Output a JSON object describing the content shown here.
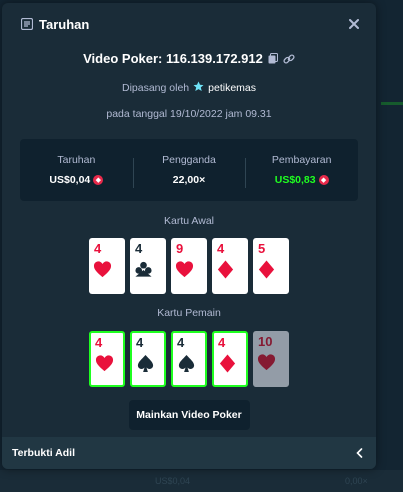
{
  "modal": {
    "title": "Taruhan",
    "game_label": "Video Poker: 116.139.172.912",
    "placed_by_prefix": "Dipasang oleh",
    "username": "petikemas",
    "date_text": "pada tanggal 19/10/2022 jam 09.31"
  },
  "stats": {
    "bet_label": "Taruhan",
    "bet_value": "US$0,04",
    "multiplier_label": "Pengganda",
    "multiplier_value": "22,00×",
    "payout_label": "Pembayaran",
    "payout_value": "US$0,83"
  },
  "initial_hand": {
    "label": "Kartu Awal",
    "cards": [
      {
        "rank": "4",
        "suit": "heart"
      },
      {
        "rank": "4",
        "suit": "club"
      },
      {
        "rank": "9",
        "suit": "heart"
      },
      {
        "rank": "4",
        "suit": "diamond"
      },
      {
        "rank": "5",
        "suit": "diamond"
      }
    ]
  },
  "player_hand": {
    "label": "Kartu Pemain",
    "cards": [
      {
        "rank": "4",
        "suit": "heart",
        "held": true
      },
      {
        "rank": "4",
        "suit": "spade",
        "held": true
      },
      {
        "rank": "4",
        "suit": "spade",
        "held": true
      },
      {
        "rank": "4",
        "suit": "diamond",
        "held": true
      },
      {
        "rank": "10",
        "suit": "heart",
        "held": false
      }
    ]
  },
  "play_button": "Mainkan Video Poker",
  "fair_label": "Terbukti Adil",
  "background": {
    "amount": "US$0,04",
    "multiplier": "0,00×"
  },
  "colors": {
    "modal_bg": "#1a2c38",
    "panel_bg": "#0f212e",
    "accent_green": "#1fff20",
    "red_suit": "#e9113c",
    "coin_red": "#e8294a",
    "muted_text": "#b1bad3"
  },
  "icons": {
    "title": "bets-icon",
    "copy": "copy-icon",
    "link": "link-icon",
    "user": "star-badge-icon",
    "currency": "coin-icon",
    "close": "close-icon",
    "fair_toggle": "chevron-left-icon"
  }
}
